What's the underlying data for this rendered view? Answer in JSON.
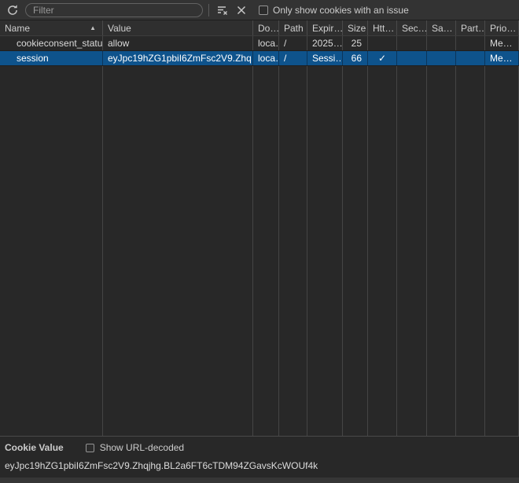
{
  "toolbar": {
    "filter_placeholder": "Filter",
    "only_show_issue_label": "Only show cookies with an issue"
  },
  "icons": {
    "sort_ascending": "▲",
    "checkmark": "✓"
  },
  "table": {
    "columns": [
      "Name",
      "Value",
      "Do…",
      "Path",
      "Expir…",
      "Size",
      "Htt…",
      "Sec…",
      "Sa…",
      "Part…",
      "Prio…"
    ],
    "rows": [
      {
        "name": "cookieconsent_status",
        "value": "allow",
        "domain": "loca…",
        "path": "/",
        "expires": "2025…",
        "size": "25",
        "http_only": "",
        "secure": "",
        "same_site": "",
        "partition_key": "",
        "priority": "Me…"
      },
      {
        "name": "session",
        "value": "eyJpc19hZG1pbiI6ZmFsc2V9.Zhq…",
        "domain": "loca…",
        "path": "/",
        "expires": "Sessi…",
        "size": "66",
        "http_only": "✓",
        "secure": "",
        "same_site": "",
        "partition_key": "",
        "priority": "Me…"
      }
    ],
    "selected_row_index": 1
  },
  "preview": {
    "title": "Cookie Value",
    "show_url_decoded_label": "Show URL-decoded",
    "value": "eyJpc19hZG1pbiI6ZmFsc2V9.Zhqjhg.BL2a6FT6cTDM94ZGavsKcWOUf4k"
  },
  "colors": {
    "selection_background": "#0e538c",
    "panel_background": "#282828",
    "toolbar_background": "#333333",
    "grid_line": "#454545"
  }
}
